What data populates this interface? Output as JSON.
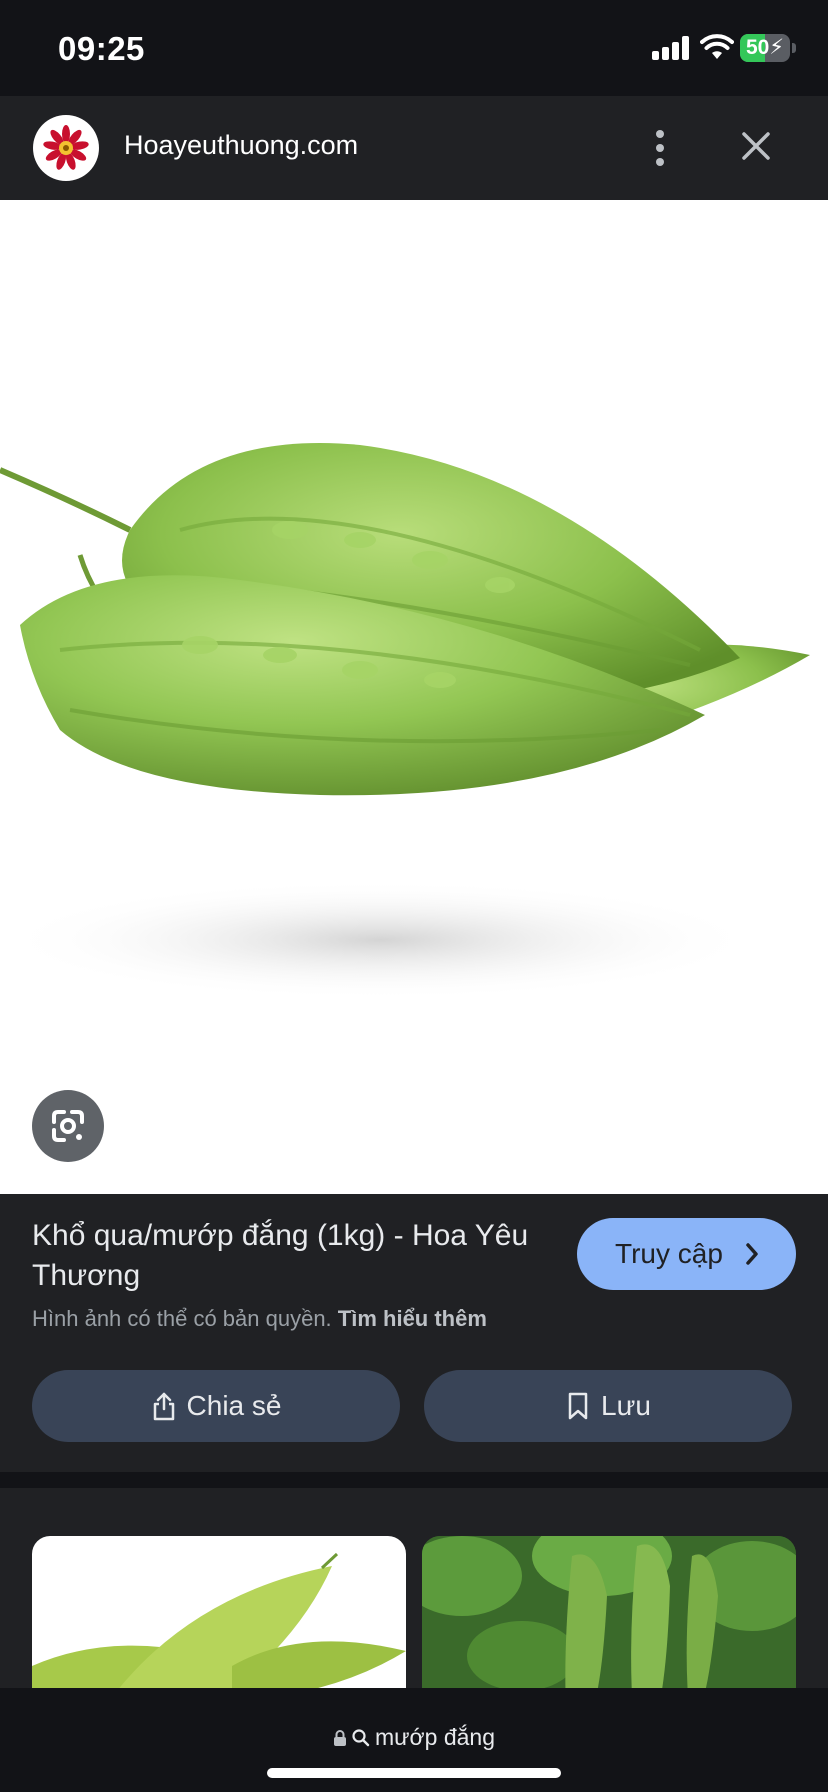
{
  "status_bar": {
    "time": "09:25",
    "battery_level": "50",
    "battery_percent": 50,
    "icons": [
      "cellular-signal-icon",
      "wifi-icon",
      "battery-charging-icon"
    ]
  },
  "header": {
    "site_name": "Hoayeuthuong.com",
    "logo": "hoayeuthuong-flower-logo",
    "icons": [
      "more-vertical-icon",
      "close-icon"
    ]
  },
  "image": {
    "subject": "bitter-melon-photo",
    "lens_icon": "google-lens-icon"
  },
  "info": {
    "title": "Khổ qua/mướp đắng (1kg) - Hoa Yêu Thương",
    "visit_label": "Truy cập",
    "copyright_text": "Hình ảnh có thể có bản quyền.",
    "learn_more_label": "Tìm hiểu thêm",
    "share_label": "Chia sẻ",
    "save_label": "Lưu"
  },
  "related": {
    "items": [
      "bitter-melon-white-thumbnail",
      "bitter-melon-vine-thumbnail"
    ]
  },
  "bottom_bar": {
    "query": "mướp đắng",
    "icons": [
      "lock-icon",
      "search-icon"
    ]
  },
  "colors": {
    "background": "#121317",
    "panel": "#202124",
    "accent_blue": "#8ab4f8",
    "button_dark": "#394457",
    "battery_green": "#34c759"
  }
}
